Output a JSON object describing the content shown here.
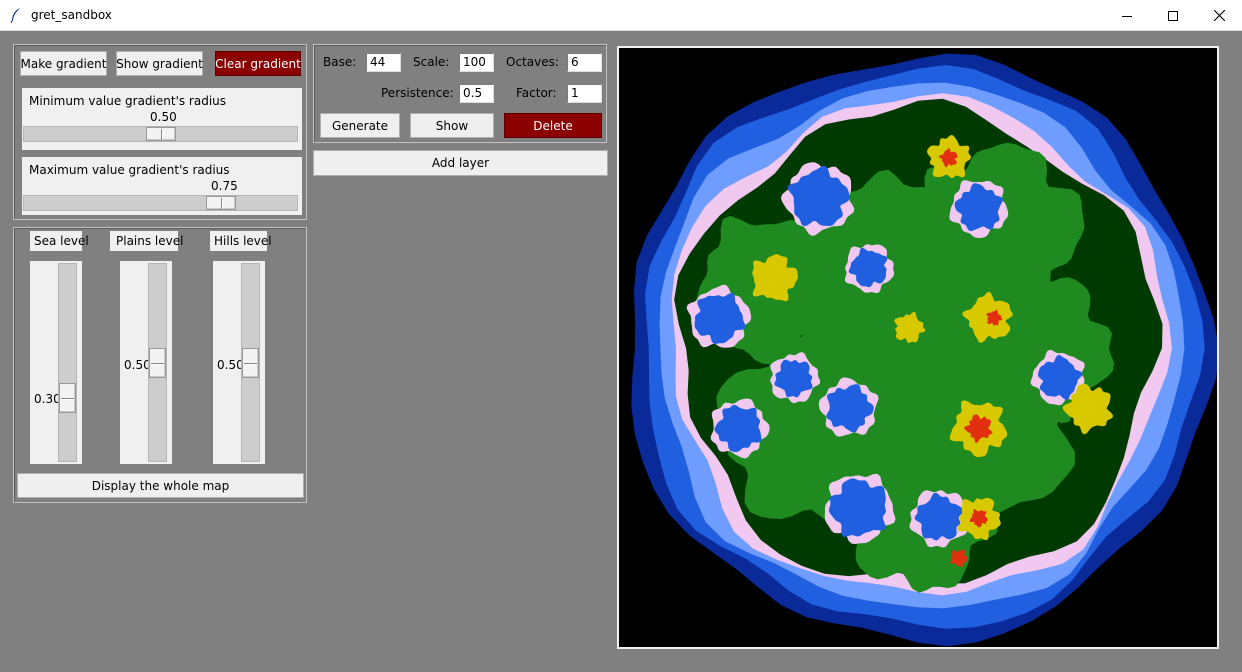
{
  "window": {
    "title": "gret_sandbox",
    "controls": [
      "minimize",
      "maximize",
      "close"
    ]
  },
  "gradient": {
    "make_label": "Make gradient",
    "show_label": "Show gradient",
    "clear_label": "Clear gradient",
    "min_radius": {
      "label": "Minimum value gradient's radius",
      "value": "0.50",
      "fraction": 0.5
    },
    "max_radius": {
      "label": "Maximum value gradient's radius",
      "value": "0.75",
      "fraction": 0.75
    }
  },
  "levels": {
    "sea": {
      "label": "Sea level",
      "value": "0.30",
      "fraction": 0.3
    },
    "plains": {
      "label": "Plains level",
      "value": "0.50",
      "fraction": 0.5
    },
    "hills": {
      "label": "Hills level",
      "value": "0.50",
      "fraction": 0.5
    },
    "display_label": "Display the whole map"
  },
  "noise": {
    "base_label": "Base:",
    "base_value": "44",
    "scale_label": "Scale:",
    "scale_value": "100",
    "octaves_label": "Octaves:",
    "octaves_value": "6",
    "persistence_label": "Persistence:",
    "persistence_value": "0.5",
    "factor_label": "Factor:",
    "factor_value": "1",
    "generate_label": "Generate",
    "show_label": "Show",
    "delete_label": "Delete",
    "add_layer_label": "Add layer"
  },
  "colors": {
    "accent_red": "#8b0000",
    "background": "#808080",
    "panel": "#f0f0f0",
    "deep_water": "#0a2a9a",
    "water": "#1f5fe0",
    "shallow": "#6e9cff",
    "beach": "#f0c8f0",
    "forest": "#003a00",
    "plains": "#1f8a1f",
    "hills": "#d8c800",
    "mountains": "#e03010"
  }
}
